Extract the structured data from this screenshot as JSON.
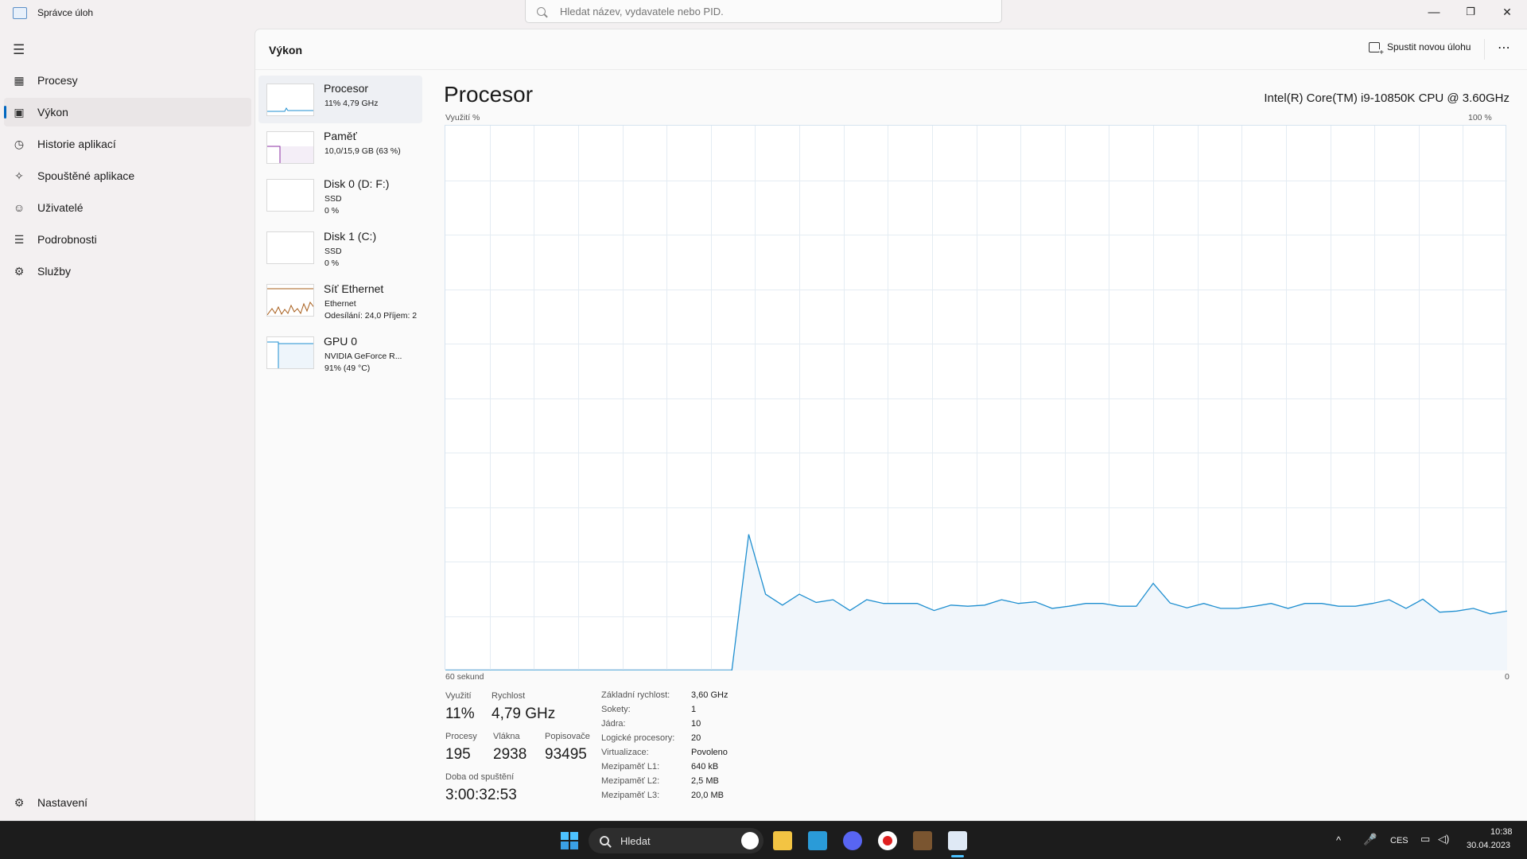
{
  "window": {
    "app_title": "Správce úloh",
    "search_placeholder": "Hledat název, vydavatele nebo PID.",
    "minimize_glyph": "—",
    "maximize_glyph": "❐",
    "close_glyph": "✕"
  },
  "sidebar": {
    "items": [
      {
        "label": "Procesy",
        "icon": "grid-icon",
        "glyph": "▦"
      },
      {
        "label": "Výkon",
        "icon": "performance-icon",
        "glyph": "▣"
      },
      {
        "label": "Historie aplikací",
        "icon": "history-icon",
        "glyph": "◷"
      },
      {
        "label": "Spouštěné aplikace",
        "icon": "startup-icon",
        "glyph": "✧"
      },
      {
        "label": "Uživatelé",
        "icon": "users-icon",
        "glyph": "☺"
      },
      {
        "label": "Podrobnosti",
        "icon": "details-icon",
        "glyph": "☰"
      },
      {
        "label": "Služby",
        "icon": "services-icon",
        "glyph": "⚙"
      }
    ],
    "settings_label": "Nastavení",
    "active_index": 1
  },
  "header": {
    "title": "Výkon",
    "run_task_label": "Spustit novou úlohu",
    "more_glyph": "⋯"
  },
  "resources": [
    {
      "name": "Procesor",
      "lines": [
        "11% 4,79 GHz"
      ],
      "color": "#1f8fd0"
    },
    {
      "name": "Paměť",
      "lines": [
        "10,0/15,9 GB (63 %)"
      ],
      "color": "#8b2fa3"
    },
    {
      "name": "Disk 0 (D: F:)",
      "lines": [
        "SSD",
        "0 %"
      ],
      "color": "#4c9a2a"
    },
    {
      "name": "Disk 1 (C:)",
      "lines": [
        "SSD",
        "0 %"
      ],
      "color": "#4c9a2a"
    },
    {
      "name": "Síť Ethernet",
      "lines": [
        "Ethernet",
        "Odesílání: 24,0 Příjem: 2"
      ],
      "color": "#a75d1a"
    },
    {
      "name": "GPU 0",
      "lines": [
        "NVIDIA GeForce R...",
        "91% (49 °C)"
      ],
      "color": "#1f8fd0"
    }
  ],
  "detail": {
    "title": "Procesor",
    "cpu_model": "Intel(R) Core(TM) i9-10850K CPU @ 3.60GHz",
    "y_label": "Využití %",
    "y_max_label": "100 %",
    "x_label": "60 sekund",
    "x_min_label": "0"
  },
  "chart_data": {
    "type": "area",
    "y_unit": "%",
    "ylim": [
      0,
      100
    ],
    "x_span_seconds": 60,
    "grid": true,
    "line_color": "#1f8fd0",
    "fill_color": "#f1f6fb",
    "series": [
      {
        "values": [
          0,
          0,
          0,
          0,
          0,
          0,
          0,
          0,
          0,
          0,
          0,
          0,
          0,
          0,
          0,
          0,
          0,
          0,
          25,
          14,
          12,
          14,
          12.5,
          13,
          11,
          13,
          12.3,
          12.3,
          12.3,
          11,
          12,
          11.8,
          12,
          13,
          12.3,
          12.6,
          11.4,
          11.8,
          12.3,
          12.3,
          11.8,
          11.8,
          16,
          12.4,
          11.5,
          12.3,
          11.4,
          11.4,
          11.8,
          12.3,
          11.4,
          12.3,
          12.3,
          11.8,
          11.8,
          12.3,
          13,
          11.4,
          13.1,
          10.7,
          10.9,
          11.4,
          10.4,
          10.9
        ]
      }
    ]
  },
  "stats": {
    "utilization_label": "Využití",
    "utilization_value": "11%",
    "speed_label": "Rychlost",
    "speed_value": "4,79 GHz",
    "processes_label": "Procesy",
    "processes_value": "195",
    "threads_label": "Vlákna",
    "threads_value": "2938",
    "handles_label": "Popisovače",
    "handles_value": "93495",
    "uptime_label": "Doba od spuštění",
    "uptime_value": "3:00:32:53"
  },
  "specs": [
    {
      "k": "Základní rychlost:",
      "v": "3,60 GHz"
    },
    {
      "k": "Sokety:",
      "v": "1"
    },
    {
      "k": "Jádra:",
      "v": "10"
    },
    {
      "k": "Logické procesory:",
      "v": "20"
    },
    {
      "k": "Virtualizace:",
      "v": "Povoleno"
    },
    {
      "k": "Mezipaměť L1:",
      "v": "640 kB"
    },
    {
      "k": "Mezipaměť L2:",
      "v": "2,5 MB"
    },
    {
      "k": "Mezipaměť L3:",
      "v": "20,0 MB"
    }
  ],
  "taskbar": {
    "search_label": "Hledat",
    "tray_chevron": "^",
    "language": "CES",
    "time": "10:38",
    "date": "30.04.2023"
  }
}
